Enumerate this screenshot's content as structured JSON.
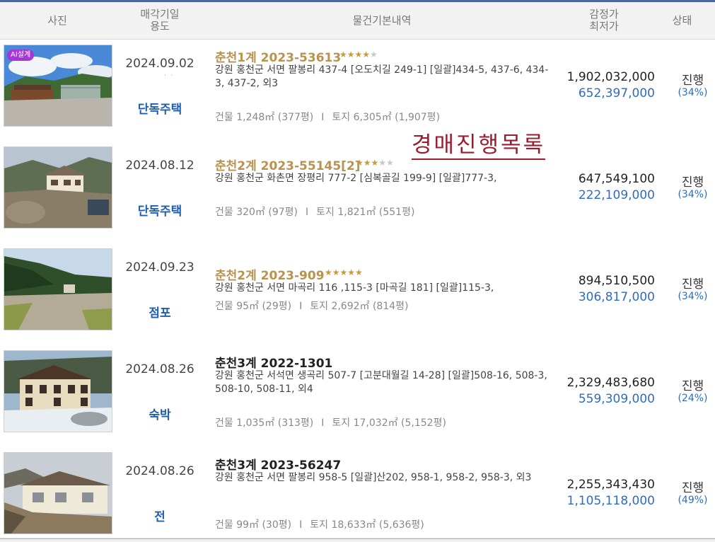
{
  "header": {
    "photo": "사진",
    "date_line1": "매각기일",
    "date_line2": "용도",
    "basic": "물건기본내역",
    "price_line1": "감정가",
    "price_line2": "최저가",
    "status": "상태"
  },
  "overlay_title": "경매진행목록",
  "colors": {
    "gold": "#b8924f",
    "blue": "#2d6bc7",
    "overlay": "#9c1c2f",
    "badge": "#a637d6"
  },
  "rows": [
    {
      "badge": "AI설계",
      "date": "2024.09.02",
      "usage": "단독주택",
      "case": "춘천1계 2023-53613",
      "stars": 4,
      "address": "강원 홍천군 서면 팔봉리 437-4 [오도치길 249-1]  [일괄]434-5, 437-6, 434-3, 437-2, 외3",
      "building": "건물 1,248㎡ (377평)",
      "land": "토지 6,305㎡ (1,907평)",
      "appraisal": "1,902,032,000",
      "minimum": "652,397,000",
      "status": "진행",
      "pct": "(34%)"
    },
    {
      "date": "2024.08.12",
      "usage": "단독주택",
      "case": "춘천2계 2023-55145[2]",
      "stars": 3,
      "address": "강원 홍천군 화촌면 장평리 777-2 [심복골길 199-9]  [일괄]777-3,",
      "building": "건물 320㎡ (97평)",
      "land": "토지 1,821㎡ (551평)",
      "appraisal": "647,549,100",
      "minimum": "222,109,000",
      "status": "진행",
      "pct": "(34%)"
    },
    {
      "date": "2024.09.23",
      "usage": "점포",
      "case": "춘천2계 2023-909",
      "stars": 5,
      "address": "강원 홍천군 서면 마곡리 116 ,115-3 [마곡길 181]  [일괄]115-3,",
      "building": "건물 95㎡ (29평)",
      "land": "토지 2,692㎡ (814평)",
      "appraisal": "894,510,500",
      "minimum": "306,817,000",
      "status": "진행",
      "pct": "(34%)"
    },
    {
      "date": "2024.08.26",
      "usage": "숙박",
      "case": "춘천3계 2022-1301",
      "address": "강원 홍천군 서석면 생곡리 507-7 [고분대월길 14-28]  [일괄]508-16, 508-3, 508-10, 508-11, 외4",
      "building": "건물 1,035㎡ (313평)",
      "land": "토지 17,032㎡ (5,152평)",
      "appraisal": "2,329,483,680",
      "minimum": "559,309,000",
      "status": "진행",
      "pct": "(24%)"
    },
    {
      "date": "2024.08.26",
      "usage": "전",
      "case": "춘천3계 2023-56247",
      "address": "강원 홍천군 서면 팔봉리 958-5  [일괄]산202, 958-1, 958-2, 958-3, 외3",
      "building": "건물 99㎡ (30평)",
      "land": "토지 18,633㎡ (5,636평)",
      "appraisal": "2,255,343,430",
      "minimum": "1,105,118,000",
      "status": "진행",
      "pct": "(49%)"
    }
  ]
}
